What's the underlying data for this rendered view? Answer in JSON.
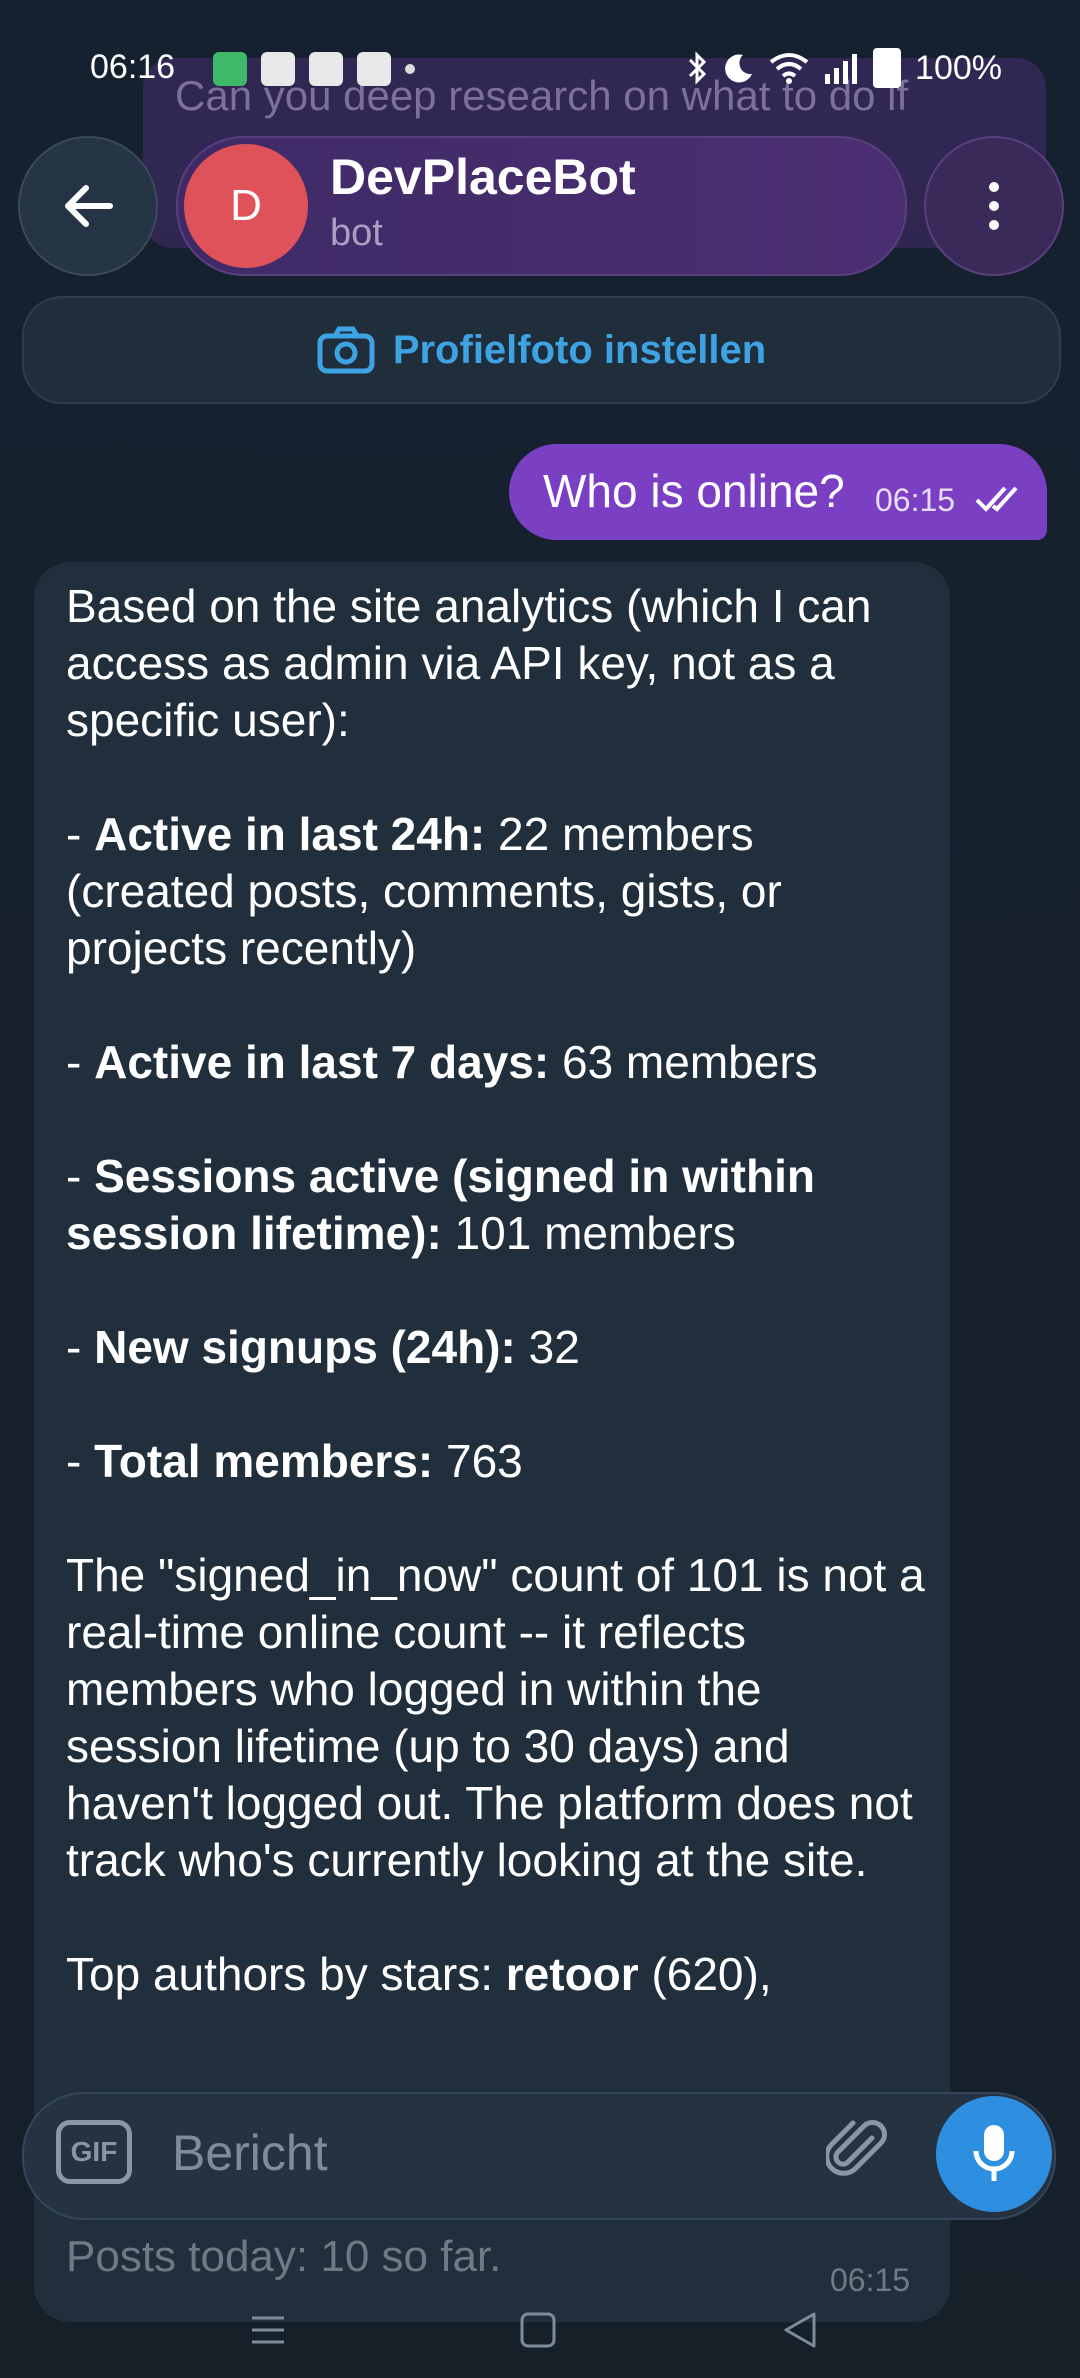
{
  "status_bar": {
    "time": "06:16",
    "battery": "100%"
  },
  "ghost_message": {
    "text": "Can you deep research on what to do if"
  },
  "header": {
    "avatar_letter": "D",
    "bot_name": "DevPlaceBot",
    "subtitle": "bot"
  },
  "profile_banner": {
    "label": "Profielfoto instellen"
  },
  "outgoing": {
    "text": "Who is online?",
    "time": "06:15"
  },
  "incoming": {
    "intro": "Based on the site analytics (which I can access as admin via API key, not as a specific user):",
    "items": [
      {
        "label": "Active in last 24h:",
        "value": " 22 members (created posts, comments, gists, or projects recently)"
      },
      {
        "label": "Active in last 7 days:",
        "value": " 63 members"
      },
      {
        "label": "Sessions active (signed in within session lifetime):",
        "value": " 101 members"
      },
      {
        "label": "New signups (24h):",
        "value": " 32"
      },
      {
        "label": "Total members:",
        "value": " 763"
      }
    ],
    "note": "The \"signed_in_now\" count of 101 is not a real-time online count -- it reflects members who logged in within the session lifetime (up to 30 days) and haven't logged out. The platform does not track who's currently looking at the site.",
    "top_authors_prefix": "Top authors by stars: ",
    "top_authors_bold": "retoor",
    "top_authors_rest": " (620),",
    "posts_today": "Posts today: 10 so far.",
    "time": "06:15"
  },
  "composer": {
    "gif_label": "GIF",
    "placeholder": "Bericht"
  },
  "colors": {
    "background": "#16202b",
    "accent_purple": "#7b3fc4",
    "link_blue": "#3ea3e3",
    "avatar_red": "#e0525a",
    "mic_blue": "#2e8fe0"
  },
  "icons": {
    "back": "arrow-left-icon",
    "menu": "more-vertical-icon",
    "camera": "camera-icon",
    "read": "double-check-icon",
    "attach": "paperclip-icon",
    "mic": "microphone-icon"
  }
}
